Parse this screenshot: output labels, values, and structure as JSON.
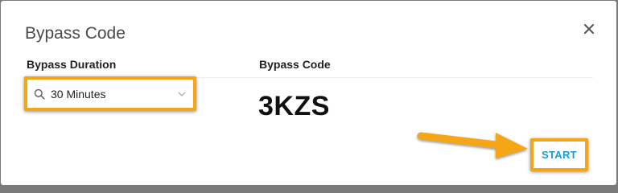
{
  "dialog": {
    "title": "Bypass Code",
    "close_icon": "close-icon"
  },
  "bypass_duration": {
    "label": "Bypass Duration",
    "selected_value": "30 Minutes",
    "icon": "search-icon"
  },
  "bypass_code": {
    "label": "Bypass Code",
    "value": "3KZS"
  },
  "actions": {
    "start_label": "START"
  },
  "colors": {
    "highlight": "#f5a614",
    "accent": "#1e9ad6",
    "overlay": "#7a7a7a"
  }
}
